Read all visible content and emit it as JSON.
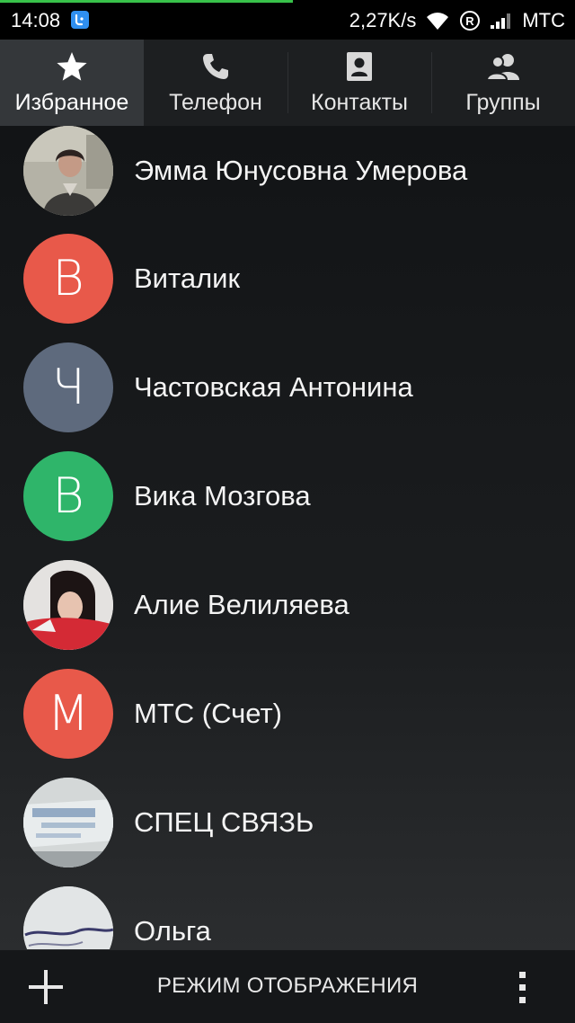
{
  "status_bar": {
    "time": "14:08",
    "speed": "2,27K/s",
    "carrier": "МТС",
    "progress_fraction": 0.51,
    "icons": [
      "notification-app-icon",
      "wifi-icon",
      "roaming-icon",
      "signal-icon"
    ]
  },
  "tabs": [
    {
      "label": "Избранное",
      "icon": "star-icon",
      "active": true
    },
    {
      "label": "Телефон",
      "icon": "phone-icon",
      "active": false
    },
    {
      "label": "Контакты",
      "icon": "contact-book-icon",
      "active": false
    },
    {
      "label": "Группы",
      "icon": "group-icon",
      "active": false
    }
  ],
  "contacts": [
    {
      "name": "Эмма Юнусовна Умерова",
      "avatar_type": "photo",
      "avatar_letter": ""
    },
    {
      "name": "Виталик",
      "avatar_type": "letter",
      "avatar_letter": "В",
      "avatar_color": "#e8594a"
    },
    {
      "name": "Частовская Антонина",
      "avatar_type": "letter",
      "avatar_letter": "Ч",
      "avatar_color": "#5e6a7d"
    },
    {
      "name": "Вика Мозгова",
      "avatar_type": "letter",
      "avatar_letter": "В",
      "avatar_color": "#2fb56a"
    },
    {
      "name": "Алие Велиляева",
      "avatar_type": "photo",
      "avatar_letter": ""
    },
    {
      "name": "МТС (Счет)",
      "avatar_type": "letter",
      "avatar_letter": "М",
      "avatar_color": "#e8594a"
    },
    {
      "name": "СПЕЦ СВЯЗЬ",
      "avatar_type": "photo",
      "avatar_letter": ""
    },
    {
      "name": "Ольга",
      "avatar_type": "photo",
      "avatar_letter": ""
    }
  ],
  "bottom_bar": {
    "add_icon": "plus-icon",
    "display_mode_label": "РЕЖИМ ОТОБРАЖЕНИЯ",
    "more_icon": "overflow-menu-icon"
  },
  "colors": {
    "progress": "#38c24a",
    "tab_active_bg": "#34373a",
    "avatar_red": "#e8594a",
    "avatar_slate": "#5e6a7d",
    "avatar_green": "#2fb56a"
  }
}
